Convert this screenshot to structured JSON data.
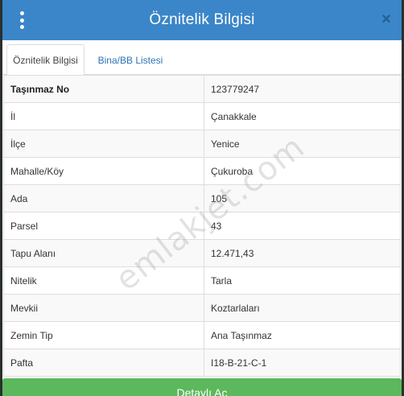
{
  "dialog": {
    "title": "Öznitelik Bilgisi"
  },
  "tabs": [
    {
      "label": "Öznitelik Bilgisi",
      "active": true
    },
    {
      "label": "Bina/BB Listesi",
      "active": false
    }
  ],
  "rows": [
    {
      "key": "Taşınmaz No",
      "value": "123779247"
    },
    {
      "key": "İl",
      "value": "Çanakkale"
    },
    {
      "key": "İlçe",
      "value": "Yenice"
    },
    {
      "key": "Mahalle/Köy",
      "value": "Çukuroba"
    },
    {
      "key": "Ada",
      "value": "105"
    },
    {
      "key": "Parsel",
      "value": "43"
    },
    {
      "key": "Tapu Alanı",
      "value": "12.471,43"
    },
    {
      "key": "Nitelik",
      "value": "Tarla"
    },
    {
      "key": "Mevkii",
      "value": "Koztarlaları"
    },
    {
      "key": "Zemin Tip",
      "value": "Ana Taşınmaz"
    },
    {
      "key": "Pafta",
      "value": "I18-B-21-C-1"
    }
  ],
  "footer": {
    "button_label": "Detaylı Aç"
  },
  "watermark": "emlakjet.com",
  "colors": {
    "header": "#3a86c8",
    "tab_link": "#2f74b5",
    "footer_button": "#5cb85c"
  }
}
